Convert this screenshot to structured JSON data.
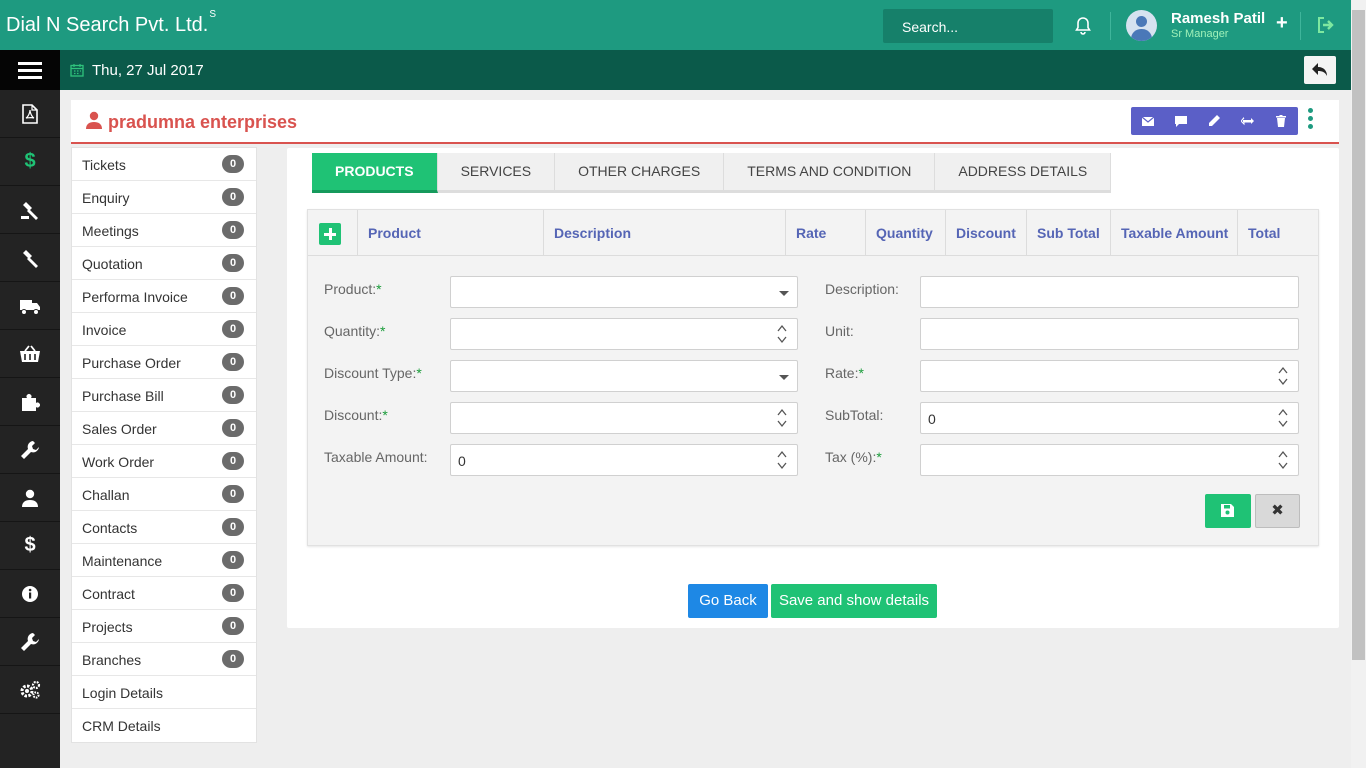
{
  "header": {
    "brand": "Dial N Search Pvt. Ltd.",
    "brand_sup": "S",
    "search_placeholder": "Search...",
    "user_name": "Ramesh Patil",
    "user_role": "Sr Manager"
  },
  "datebar": {
    "date": "Thu, 27 Jul 2017"
  },
  "rail": {
    "icons": [
      "file-pdf-icon",
      "dollar-icon",
      "gavel-icon",
      "gavel-icon",
      "truck-icon",
      "basket-icon",
      "puzzle-icon",
      "wrench-icon",
      "user-icon",
      "dollar-icon",
      "info-icon",
      "wrench-icon",
      "cogs-icon"
    ],
    "dollar": "$",
    "active_color": "#1fc275"
  },
  "customer": {
    "name": "pradumna enterprises"
  },
  "sidemenu": [
    {
      "label": "Tickets",
      "count": "0"
    },
    {
      "label": "Enquiry",
      "count": "0"
    },
    {
      "label": "Meetings",
      "count": "0"
    },
    {
      "label": "Quotation",
      "count": "0"
    },
    {
      "label": "Performa Invoice",
      "count": "0"
    },
    {
      "label": "Invoice",
      "count": "0"
    },
    {
      "label": "Purchase Order",
      "count": "0"
    },
    {
      "label": "Purchase Bill",
      "count": "0"
    },
    {
      "label": "Sales Order",
      "count": "0"
    },
    {
      "label": "Work Order",
      "count": "0"
    },
    {
      "label": "Challan",
      "count": "0"
    },
    {
      "label": "Contacts",
      "count": "0"
    },
    {
      "label": "Maintenance",
      "count": "0"
    },
    {
      "label": "Contract",
      "count": "0"
    },
    {
      "label": "Projects",
      "count": "0"
    },
    {
      "label": "Branches",
      "count": "0"
    },
    {
      "label": "Login Details",
      "count": null
    },
    {
      "label": "CRM Details",
      "count": null
    }
  ],
  "tabs": [
    "PRODUCTS",
    "SERVICES",
    "OTHER CHARGES",
    "TERMS AND CONDITION",
    "ADDRESS DETAILS"
  ],
  "table": {
    "columns": [
      "Product",
      "Description",
      "Rate",
      "Quantity",
      "Discount",
      "Sub Total",
      "Taxable Amount",
      "Total"
    ]
  },
  "form": {
    "product_label": "Product:",
    "description_label": "Description:",
    "quantity_label": "Quantity:",
    "unit_label": "Unit:",
    "discount_type_label": "Discount Type:",
    "rate_label": "Rate:",
    "discount_label": "Discount:",
    "subtotal_label": "SubTotal:",
    "subtotal_value": "0",
    "taxable_label": "Taxable Amount:",
    "taxable_value": "0",
    "tax_label": "Tax (%):",
    "required_mark": "*",
    "close_symbol": "✖"
  },
  "buttons": {
    "go_back": "Go Back",
    "save_show": "Save and show details"
  }
}
